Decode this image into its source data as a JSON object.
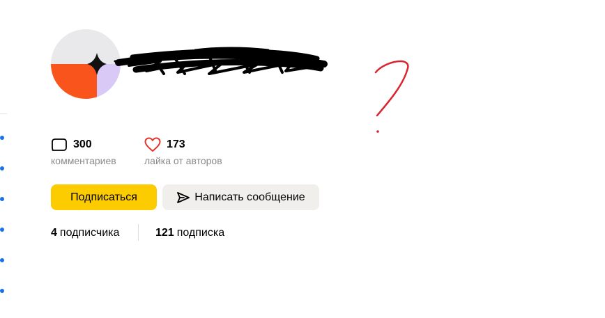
{
  "profile": {
    "avatar": {
      "colors": {
        "top": "#e9e9ec",
        "bottom_left": "#f9541c",
        "bottom_right": "#d8c9f6",
        "sparkle": "#111111"
      }
    },
    "name_obscured": true
  },
  "stats": {
    "comments": {
      "icon": "comment-bubble-icon",
      "value": "300",
      "caption": "комментариев"
    },
    "likes": {
      "icon": "heart-icon",
      "value": "173",
      "caption": "лайка от авторов"
    }
  },
  "actions": {
    "subscribe_label": "Подписаться",
    "message_label": "Написать сообщение",
    "message_icon": "send-icon"
  },
  "follow": {
    "followers_count": "4",
    "followers_label": "подписчика",
    "following_count": "121",
    "following_label": "подписка"
  },
  "colors": {
    "accent_yellow": "#fccb00",
    "secondary_button": "#f0efec",
    "heart_red": "#e2342c",
    "rail_dot_blue": "#1a73e8",
    "annotation_red": "#d9232e"
  }
}
